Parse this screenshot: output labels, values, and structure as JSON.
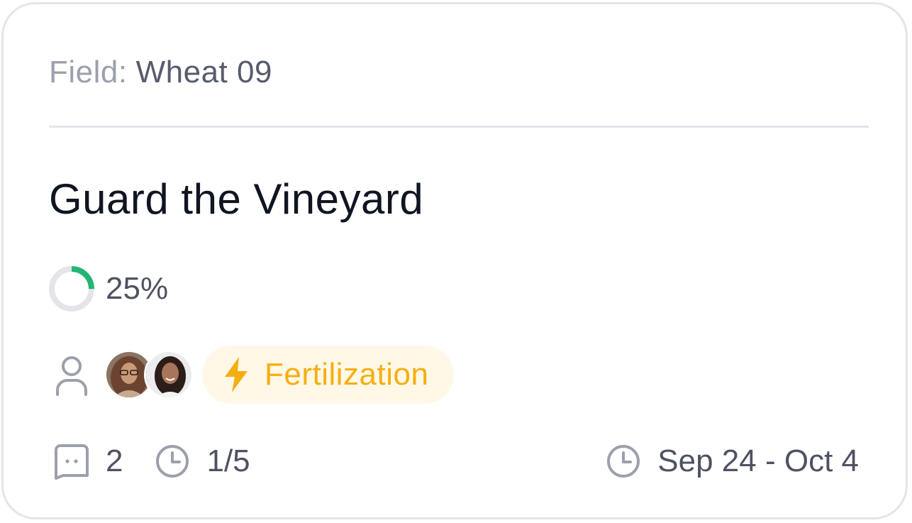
{
  "card": {
    "field_label": "Field:",
    "field_value": "Wheat 09",
    "title": "Guard the Vineyard",
    "progress": {
      "value": 0.25,
      "label": "25%",
      "color": "#22b573",
      "track_color": "#e4e5ea"
    },
    "assignees_icon": "user-icon",
    "assignees": [
      {
        "avatar": "woman-with-glasses-avatar"
      },
      {
        "avatar": "smiling-woman-avatar"
      }
    ],
    "tag": {
      "icon": "lightning-icon",
      "label": "Fertilization",
      "color": "#f5ae12",
      "background": "#fff8e6"
    },
    "meta": {
      "comments_icon": "comment-icon",
      "comments_count": "2",
      "tasks_icon": "clock-icon",
      "tasks_progress": "1/5",
      "date_icon": "clock-icon",
      "date_range": "Sep 24 - Oct 4"
    }
  }
}
